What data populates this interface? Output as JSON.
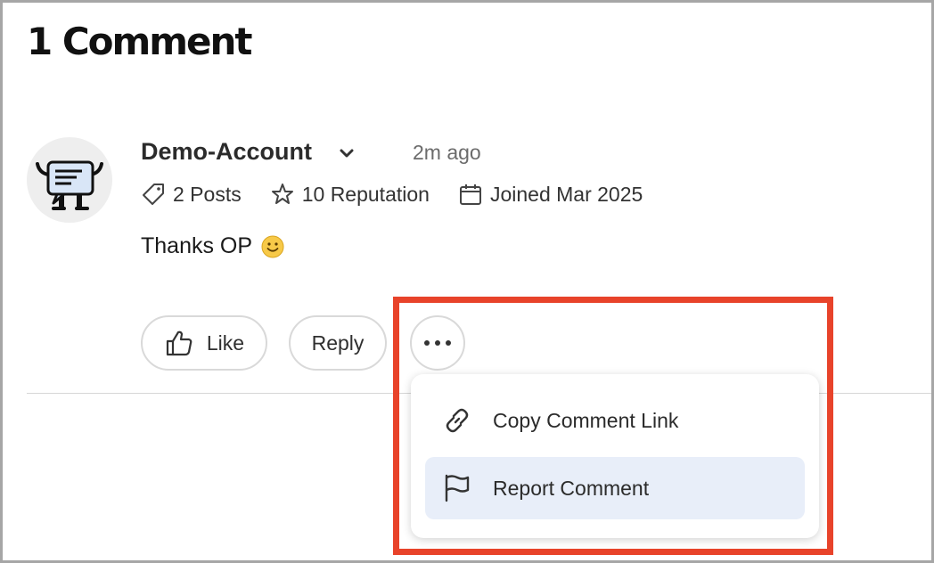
{
  "heading": "1 Comment",
  "comment": {
    "author": "Demo-Account",
    "time": "2m ago",
    "stats": {
      "posts": "2 Posts",
      "reputation": "10 Reputation",
      "joined": "Joined Mar 2025"
    },
    "text": "Thanks OP"
  },
  "actions": {
    "like": "Like",
    "reply": "Reply"
  },
  "menu": {
    "items": [
      {
        "label": "Copy Comment Link",
        "icon": "link-icon"
      },
      {
        "label": "Report Comment",
        "icon": "flag-icon"
      }
    ]
  },
  "colors": {
    "highlight_border": "#e8432a",
    "menu_hover": "#e8eef9",
    "avatar_bg": "#eeeeee"
  }
}
